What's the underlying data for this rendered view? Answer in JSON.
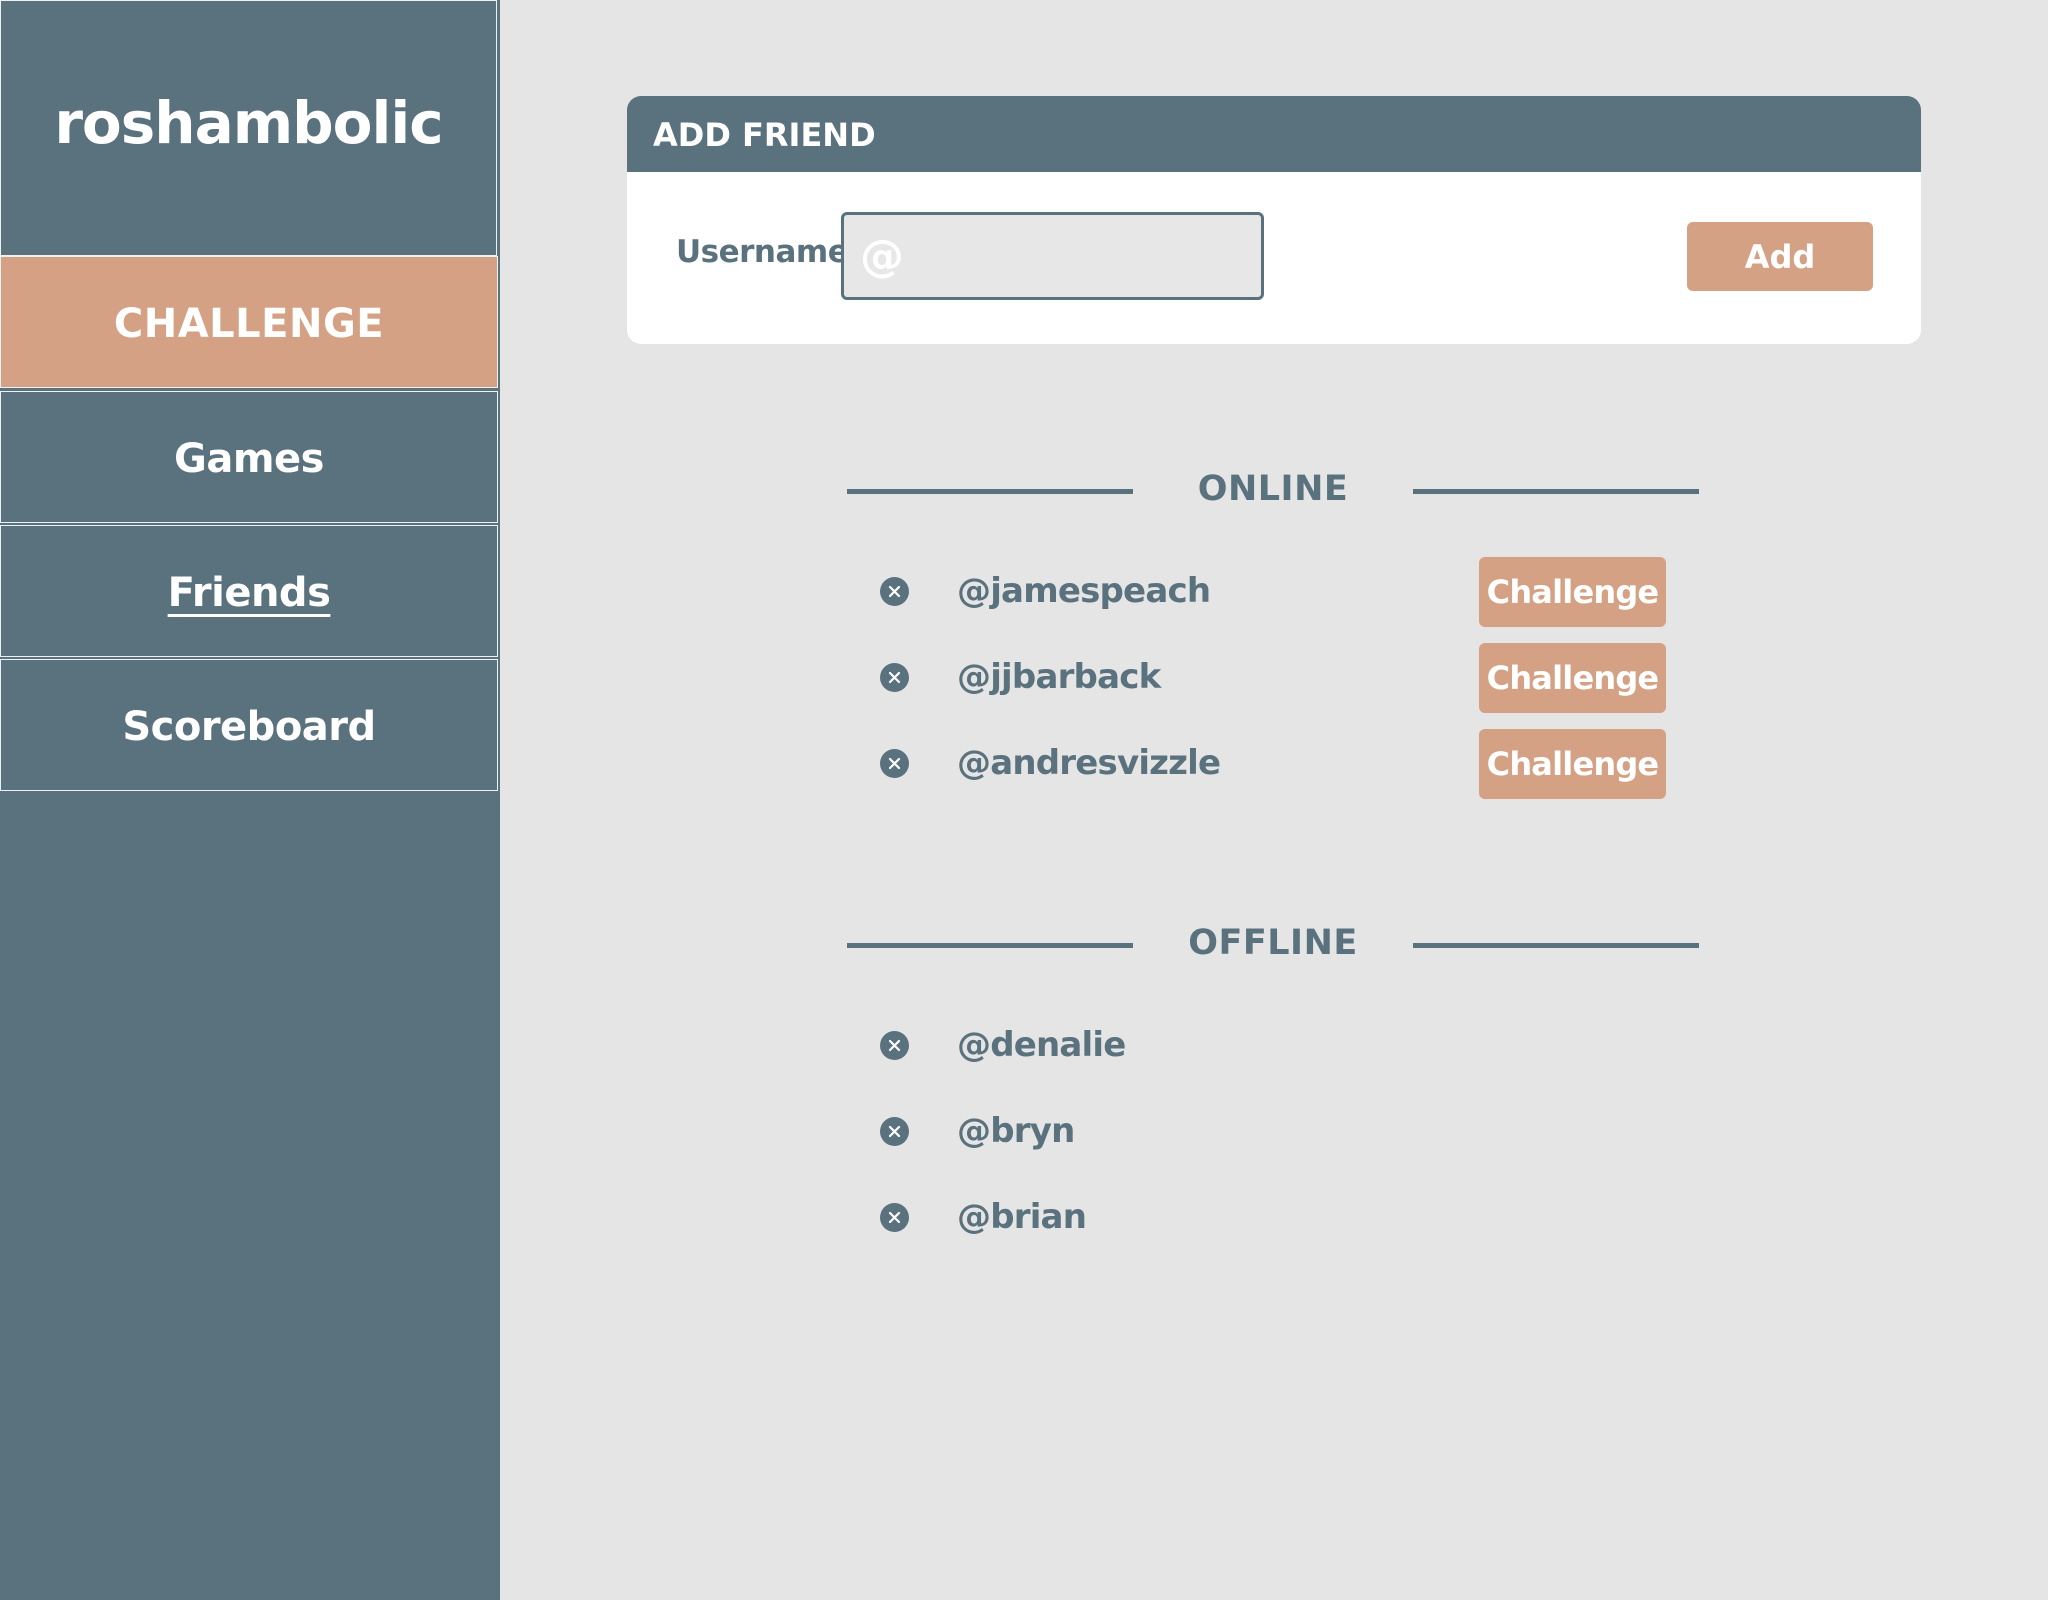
{
  "app": {
    "brand": "roshambolic"
  },
  "nav": {
    "challenge": "CHALLENGE",
    "games": "Games",
    "friends": "Friends",
    "scoreboard": "Scoreboard"
  },
  "add_friend": {
    "title": "ADD FRIEND",
    "field_label": "Username",
    "input_placeholder": "@",
    "input_value": "",
    "add_label": "Add"
  },
  "online": {
    "title": "ONLINE",
    "friends": [
      {
        "username": "@jamespeach",
        "action": "Challenge"
      },
      {
        "username": "@jjbarback",
        "action": "Challenge"
      },
      {
        "username": "@andresvizzle",
        "action": "Challenge"
      }
    ]
  },
  "offline": {
    "title": "OFFLINE",
    "friends": [
      {
        "username": "@denalie"
      },
      {
        "username": "@bryn"
      },
      {
        "username": "@brian"
      }
    ]
  },
  "icons": {
    "remove": "close-circle-icon"
  },
  "colors": {
    "primary": "#5a717e",
    "accent": "#d4a185",
    "background": "#e5e5e5",
    "card": "#ffffff"
  }
}
